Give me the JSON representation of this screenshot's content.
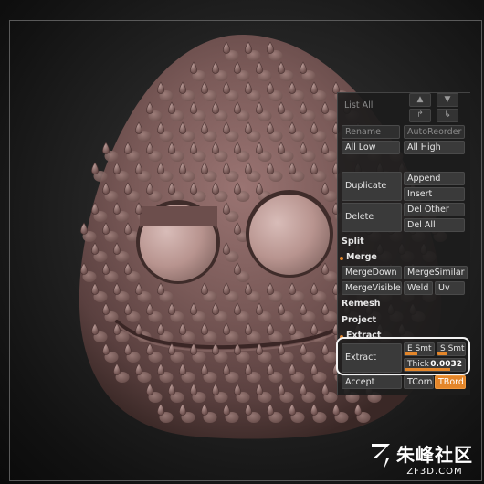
{
  "panel": {
    "list_all": "List All",
    "rename": "Rename",
    "auto_reorder": "AutoReorder",
    "all_low": "All Low",
    "all_high": "All High",
    "duplicate": "Duplicate",
    "append": "Append",
    "insert": "Insert",
    "delete": "Delete",
    "del_other": "Del Other",
    "del_all": "Del All",
    "split": "Split",
    "merge": "Merge",
    "merge_down": "MergeDown",
    "merge_similar": "MergeSimilar",
    "merge_visible": "MergeVisible",
    "weld": "Weld",
    "uv": "Uv",
    "remesh": "Remesh",
    "project": "Project",
    "extract_section": "Extract",
    "extract_button": "Extract",
    "e_smt": "E Smt",
    "s_smt": "S Smt",
    "thick_label": "Thick",
    "thick_value": "0.0032",
    "accept": "Accept",
    "tcorner": "TCorn",
    "tborder": "TBord"
  },
  "colors": {
    "accent": "#e4862a",
    "mesh": "#7a5a58",
    "panel_bg": "#1c1c1c",
    "button_bg": "#3a3a3a"
  },
  "watermark": {
    "chinese": "朱峰社区",
    "site": "ZF3D.COM"
  }
}
